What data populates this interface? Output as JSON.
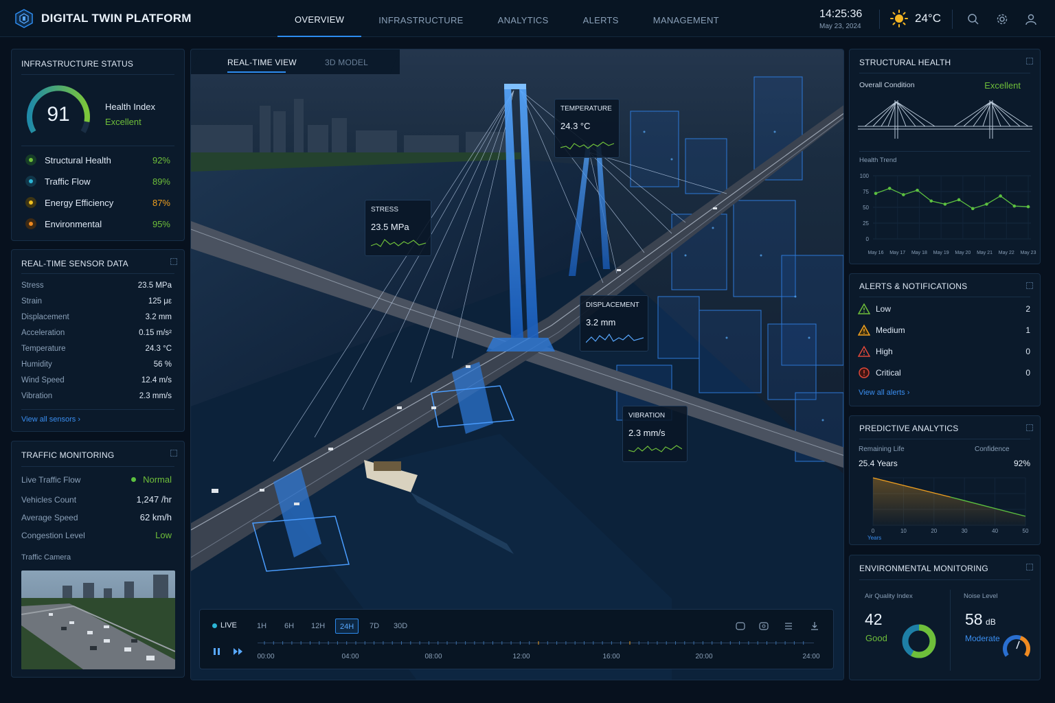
{
  "app": {
    "title": "DIGITAL TWIN PLATFORM"
  },
  "nav": {
    "tabs": [
      "OVERVIEW",
      "INFRASTRUCTURE",
      "ANALYTICS",
      "ALERTS",
      "MANAGEMENT"
    ],
    "active": "OVERVIEW"
  },
  "header": {
    "time": "14:25:36",
    "date": "May 23, 2024",
    "temperature": "24°C",
    "weather_icon": "sun-icon",
    "icons": [
      "search-icon",
      "gear-icon",
      "user-icon"
    ]
  },
  "colors": {
    "accent": "#2d8cf0",
    "good": "#6fbf3a",
    "warning": "#f0a020",
    "danger": "#e0483a",
    "teal": "#2bb5d6"
  },
  "infrastructure_status": {
    "title": "INFRASTRUCTURE STATUS",
    "health_score": "91",
    "health_fraction": 0.91,
    "health_label": "Health Index",
    "health_value": "Excellent",
    "items": [
      {
        "label": "Structural Health",
        "value": "92%",
        "color": "#6fbf3a"
      },
      {
        "label": "Traffic Flow",
        "value": "89%",
        "color": "#2bb5d6"
      },
      {
        "label": "Energy Efficiency",
        "value": "87%",
        "color": "#f0c020"
      },
      {
        "label": "Environmental",
        "value": "95%",
        "color": "#f08a20"
      }
    ]
  },
  "sensor_data": {
    "title": "REAL-TIME SENSOR DATA",
    "rows": [
      {
        "label": "Stress",
        "value": "23.5 MPa"
      },
      {
        "label": "Strain",
        "value": "125 με"
      },
      {
        "label": "Displacement",
        "value": "3.2 mm"
      },
      {
        "label": "Acceleration",
        "value": "0.15 m/s²"
      },
      {
        "label": "Temperature",
        "value": "24.3 °C"
      },
      {
        "label": "Humidity",
        "value": "56 %"
      },
      {
        "label": "Wind Speed",
        "value": "12.4 m/s"
      },
      {
        "label": "Vibration",
        "value": "2.3 mm/s"
      }
    ],
    "link": "View all sensors ›"
  },
  "traffic": {
    "title": "TRAFFIC MONITORING",
    "live_label": "Live Traffic Flow",
    "live_value": "Normal",
    "vehicles_label": "Vehicles Count",
    "vehicles_value": "1,247 /hr",
    "speed_label": "Average Speed",
    "speed_value": "62 km/h",
    "congestion_label": "Congestion Level",
    "congestion_value": "Low",
    "camera_label": "Traffic Camera"
  },
  "center": {
    "tabs": [
      "REAL-TIME VIEW",
      "3D MODEL"
    ],
    "active_tab": "REAL-TIME VIEW",
    "sensors": [
      {
        "title": "TEMPERATURE",
        "value": "24.3 °C"
      },
      {
        "title": "STRESS",
        "value": "23.5 MPa"
      },
      {
        "title": "DISPLACEMENT",
        "value": "3.2 mm"
      },
      {
        "title": "VIBRATION",
        "value": "2.3 mm/s"
      }
    ],
    "timeline": {
      "live": "LIVE",
      "ranges": [
        "1H",
        "6H",
        "12H",
        "24H",
        "7D",
        "30D"
      ],
      "selected": "24H",
      "ticks": [
        "00:00",
        "04:00",
        "08:00",
        "12:00",
        "16:00",
        "20:00",
        "24:00"
      ]
    }
  },
  "structural_health": {
    "title": "STRUCTURAL HEALTH",
    "overall_label": "Overall Condition",
    "overall_value": "Excellent",
    "trend_label": "Health Trend",
    "chart_data": {
      "type": "line",
      "x": [
        "May 16",
        "May 17",
        "May 18",
        "May 19",
        "May 20",
        "May 21",
        "May 22",
        "May 23"
      ],
      "y_ticks": [
        "100",
        "75",
        "50",
        "25",
        "0"
      ],
      "ylim": [
        0,
        100
      ],
      "values": [
        72,
        80,
        70,
        77,
        60,
        55,
        62,
        48,
        55,
        68,
        52,
        51
      ]
    }
  },
  "alerts": {
    "title": "ALERTS & NOTIFICATIONS",
    "rows": [
      {
        "label": "Low",
        "count": "2",
        "color": "#6fbf3a"
      },
      {
        "label": "Medium",
        "count": "1",
        "color": "#f0a020"
      },
      {
        "label": "High",
        "count": "0",
        "color": "#e0483a"
      },
      {
        "label": "Critical",
        "count": "0",
        "color": "#e0483a"
      }
    ],
    "link": "View all alerts ›"
  },
  "predictive": {
    "title": "PREDICTIVE ANALYTICS",
    "remaining_label": "Remaining Life",
    "remaining_value": "25.4 Years",
    "confidence_label": "Confidence",
    "confidence_value": "92%",
    "chart_data": {
      "type": "area",
      "x_ticks": [
        "0",
        "10",
        "20",
        "30",
        "40",
        "50"
      ],
      "xlabel": "Years",
      "xlim": [
        0,
        50
      ],
      "points": [
        [
          0,
          100
        ],
        [
          25.4,
          60
        ],
        [
          50,
          20
        ]
      ]
    }
  },
  "environmental": {
    "title": "ENVIRONMENTAL MONITORING",
    "aqi_label": "Air Quality Index",
    "aqi_value": "42",
    "aqi_status": "Good",
    "aqi_fraction": 0.42,
    "noise_label": "Noise Level",
    "noise_value": "58",
    "noise_unit": "dB",
    "noise_status": "Moderate",
    "noise_fraction": 0.58
  }
}
